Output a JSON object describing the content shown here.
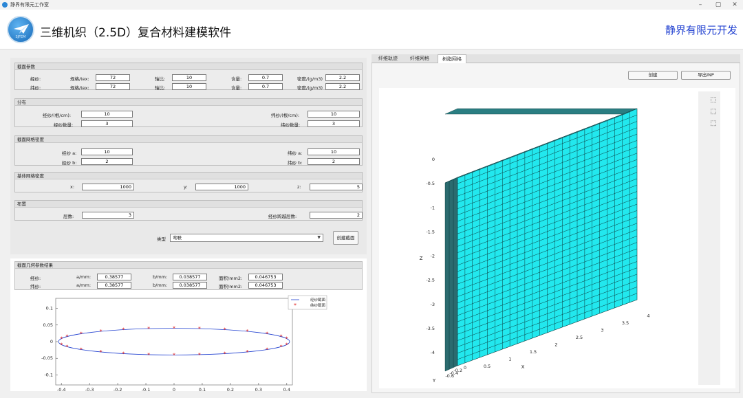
{
  "window": {
    "title": "静界有限元工作室",
    "controls": [
      "–",
      "▢",
      "✕"
    ]
  },
  "header": {
    "app_title": "三维机织（2.5D）复合材料建模软件",
    "brand": "静界有限元开发",
    "logo_text": "SJFEM"
  },
  "section_params": {
    "title": "截面参数",
    "warp": {
      "label": "经纱:",
      "spec_label": "规格/tex:",
      "spec": "72",
      "ratio_label": "轴比:",
      "ratio": "10",
      "content_label": "含量:",
      "content": "0.7",
      "density_label": "密度/(g/m3)",
      "density": "2.2"
    },
    "weft": {
      "label": "纬纱:",
      "spec_label": "规格/tex:",
      "spec": "72",
      "ratio_label": "轴比:",
      "ratio": "10",
      "content_label": "含量:",
      "content": "0.7",
      "density_label": "密度/(g/m3)",
      "density": "2.2"
    }
  },
  "section_distribution": {
    "title": "分布",
    "warp_density_label": "经纱/(根/cm):",
    "warp_density": "10",
    "weft_density_label": "纬纱/(根/cm):",
    "weft_density": "10",
    "warp_count_label": "经纱数量:",
    "warp_count": "3",
    "weft_count_label": "纬纱数量:",
    "weft_count": "3"
  },
  "section_mesh_density": {
    "title": "截面网格密度",
    "warp_a_label": "经纱 a:",
    "warp_a": "10",
    "weft_a_label": "纬纱 a:",
    "weft_a": "10",
    "warp_b_label": "经纱 b:",
    "warp_b": "2",
    "weft_b_label": "纬纱 b:",
    "weft_b": "2"
  },
  "section_matrix_mesh": {
    "title": "基体网格密度",
    "x_label": "x:",
    "x": "1000",
    "y_label": "y:",
    "y": "1000",
    "z_label": "z:",
    "z": "5"
  },
  "section_layout": {
    "title": "布置",
    "layers_label": "层数:",
    "layers": "3",
    "cross_label": "经纱跨越层数:",
    "cross": "2"
  },
  "type_row": {
    "label": "类型",
    "value": "弯联",
    "caret": "▼",
    "button": "创建截面"
  },
  "section_geom": {
    "title": "截面几何参数结果",
    "warp": {
      "label": "经纱:",
      "a_label": "a/mm:",
      "a": "0.38577",
      "b_label": "b/mm:",
      "b": "0.038577",
      "area_label": "面积/mm2:",
      "area": "0.046753"
    },
    "weft": {
      "label": "纬纱:",
      "a_label": "a/mm:",
      "a": "0.38577",
      "b_label": "b/mm:",
      "b": "0.038577",
      "area_label": "面积/mm2:",
      "area": "0.046753"
    }
  },
  "chart_data": {
    "type": "line",
    "x_ticks": [
      "-0.4",
      "-0.3",
      "-0.2",
      "-0.1",
      "0",
      "0.1",
      "0.2",
      "0.3",
      "0.4"
    ],
    "y_ticks": [
      "0.1",
      "0.05",
      "0",
      "-0.05",
      "-0.1"
    ],
    "xlim": [
      -0.42,
      0.42
    ],
    "ylim": [
      -0.13,
      0.13
    ],
    "ellipse": {
      "a": 0.41,
      "b": 0.04
    },
    "marker_x": [
      -0.4,
      -0.38,
      -0.33,
      -0.26,
      -0.18,
      -0.09,
      0,
      0.09,
      0.18,
      0.26,
      0.33,
      0.38,
      0.4
    ],
    "series": [
      {
        "name": "经纱截面",
        "color": "#1f3fd0",
        "style": "line"
      },
      {
        "name": "纬纱截面",
        "color": "#e02020",
        "style": "marker"
      }
    ],
    "legend": "top-right"
  },
  "right": {
    "tabs": [
      "纤维轨迹",
      "纤维网格",
      "树脂网格"
    ],
    "active_tab": 2,
    "create_button": "创建",
    "export_button": "导出INP",
    "colors": {
      "mesh_front": "#22e8ee",
      "mesh_side": "#2b6b6f",
      "mesh_top": "#2a7e82",
      "grid": "#0a3a3c"
    },
    "plot": {
      "z_ticks": [
        "0",
        "-0.5",
        "-1",
        "-1.5",
        "-2",
        "-2.5",
        "-3",
        "-3.5",
        "-4"
      ],
      "x_ticks": [
        "0.5",
        "1",
        "1.5",
        "2",
        "2.5",
        "3",
        "3.5",
        "4"
      ],
      "y_ticks": [
        "0",
        "-0.2",
        "-0.4",
        "-0.6"
      ],
      "x_label": "X",
      "y_label": "Y",
      "z_label": "Z"
    },
    "tools": [
      "cube-front-icon",
      "cube-side-icon",
      "cube-iso-icon"
    ]
  }
}
